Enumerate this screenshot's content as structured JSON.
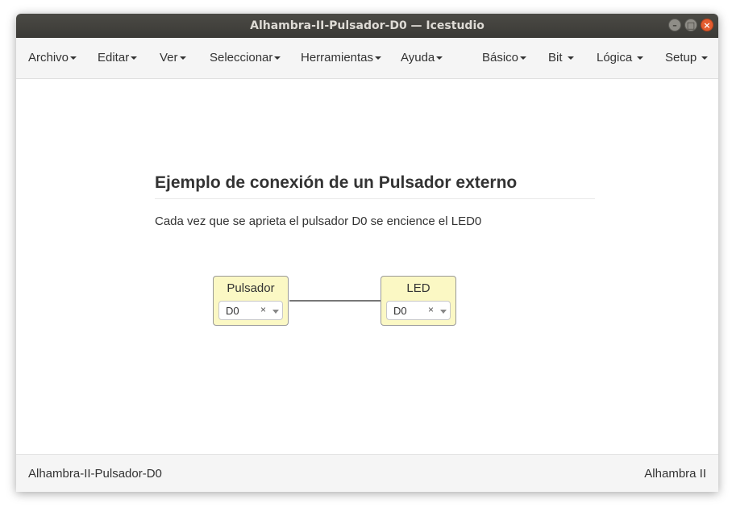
{
  "window": {
    "title": "Alhambra-II-Pulsador-D0 — Icestudio",
    "controls": {
      "minimize": "–",
      "maximize": "□",
      "close": "×"
    }
  },
  "menubar": {
    "items": [
      "Archivo",
      "Editar",
      "Ver",
      "Seleccionar",
      "Herramientas",
      "Ayuda"
    ],
    "right_items": [
      "Básico",
      "Bit",
      "Lógica",
      "Setup"
    ]
  },
  "canvas": {
    "info": {
      "title": "Ejemplo de conexión de un Pulsador externo",
      "description": "Cada vez que se aprieta el pulsador D0 se encience el LED0"
    },
    "blocks": [
      {
        "label": "Pulsador",
        "pin": "D0",
        "clear": "×"
      },
      {
        "label": "LED",
        "pin": "D0",
        "clear": "×"
      }
    ]
  },
  "footer": {
    "project": "Alhambra-II-Pulsador-D0",
    "board": "Alhambra II"
  }
}
